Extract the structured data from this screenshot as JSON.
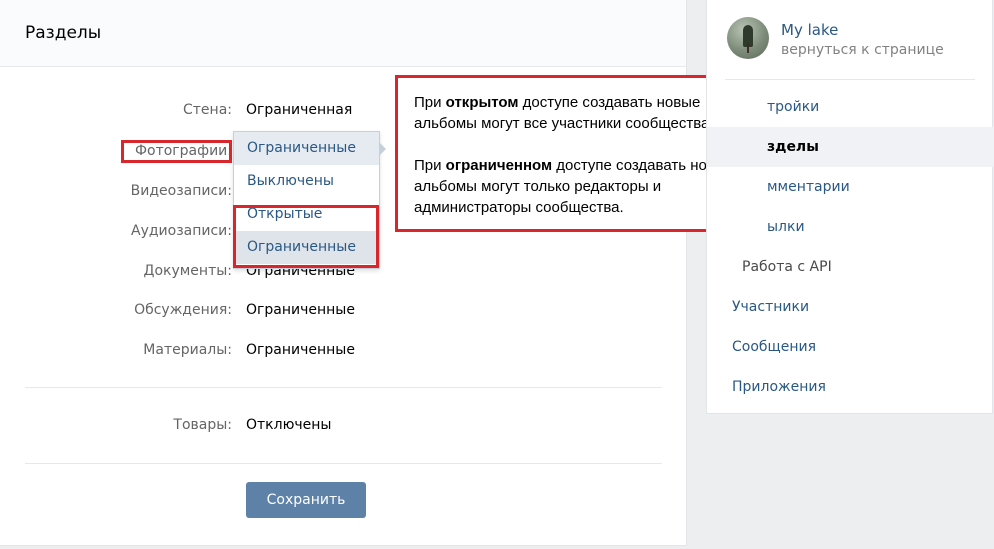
{
  "main": {
    "title": "Разделы",
    "rows": [
      {
        "label": "Стена:",
        "value": "Ограниченная"
      },
      {
        "label": "Фотографии:",
        "value": "Ограниченные"
      },
      {
        "label": "Видеозаписи:",
        "value": ""
      },
      {
        "label": "Аудиозаписи:",
        "value": ""
      },
      {
        "label": "Документы:",
        "value": "Ограниченные"
      },
      {
        "label": "Обсуждения:",
        "value": "Ограниченные"
      },
      {
        "label": "Материалы:",
        "value": "Ограниченные"
      }
    ],
    "goods": {
      "label": "Товары:",
      "value": "Отключены"
    },
    "save_label": "Сохранить"
  },
  "dropdown": {
    "options": [
      "Ограниченные",
      "Выключены",
      "Открытые",
      "Ограниченные"
    ],
    "highlighted_index": 0,
    "selected_index": 3
  },
  "tooltip": {
    "p1_before": "При ",
    "p1_bold": "открытом",
    "p1_after": " доступе создавать новые альбомы могут все участники сообщества.",
    "p2_before": "При ",
    "p2_bold": "ограниченном",
    "p2_after": " доступе создавать новые альбомы могут только редакторы и администраторы сообщества."
  },
  "sidebar": {
    "group_name": "My lake",
    "back_label": "вернуться к странице",
    "items": [
      {
        "label": "тройки"
      },
      {
        "label": "зделы"
      },
      {
        "label": "мментарии"
      },
      {
        "label": "ылки"
      },
      {
        "label": "Работа с API"
      },
      {
        "label": "Участники"
      },
      {
        "label": "Сообщения"
      },
      {
        "label": "Приложения"
      }
    ]
  },
  "colors": {
    "link": "#2a5885",
    "accent_button": "#5e81a8",
    "highlight_red": "#d9262c"
  }
}
